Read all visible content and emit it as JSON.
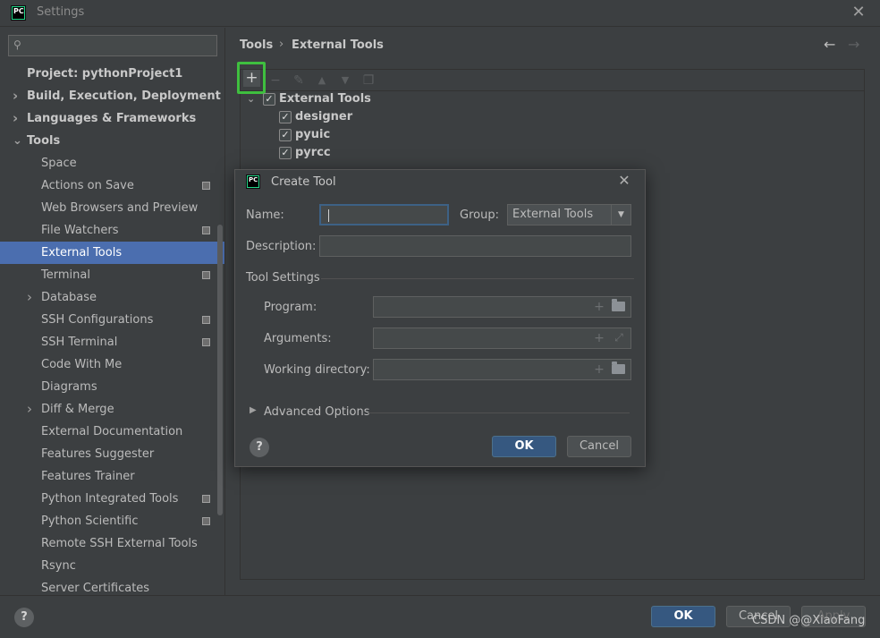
{
  "window": {
    "title": "Settings",
    "logo_text": "PC"
  },
  "sidebar": {
    "search_placeholder": "",
    "project_item": "Project: pythonProject1",
    "items": [
      {
        "label": "Build, Execution, Deployment",
        "bold": true,
        "expandable": true
      },
      {
        "label": "Languages & Frameworks",
        "bold": true,
        "expandable": true
      },
      {
        "label": "Tools",
        "bold": true,
        "expanded": true
      },
      {
        "label": "Space"
      },
      {
        "label": "Actions on Save",
        "project_scoped": true
      },
      {
        "label": "Web Browsers and Preview"
      },
      {
        "label": "File Watchers",
        "project_scoped": true
      },
      {
        "label": "External Tools",
        "selected": true
      },
      {
        "label": "Terminal",
        "project_scoped": true
      },
      {
        "label": "Database",
        "expandable": true
      },
      {
        "label": "SSH Configurations",
        "project_scoped": true
      },
      {
        "label": "SSH Terminal",
        "project_scoped": true
      },
      {
        "label": "Code With Me"
      },
      {
        "label": "Diagrams"
      },
      {
        "label": "Diff & Merge",
        "expandable": true
      },
      {
        "label": "External Documentation"
      },
      {
        "label": "Features Suggester"
      },
      {
        "label": "Features Trainer"
      },
      {
        "label": "Python Integrated Tools",
        "project_scoped": true
      },
      {
        "label": "Python Scientific",
        "project_scoped": true
      },
      {
        "label": "Remote SSH External Tools"
      },
      {
        "label": "Rsync"
      },
      {
        "label": "Server Certificates"
      }
    ]
  },
  "breadcrumb": {
    "parent": "Tools",
    "separator": "›",
    "current": "External Tools",
    "back_icon": "arrow-left-icon",
    "forward_icon": "arrow-right-icon"
  },
  "toolbar": {
    "add": "+",
    "remove": "−",
    "edit": "✎",
    "up": "▲",
    "down": "▼",
    "copy": "❐"
  },
  "tools_tree": {
    "group": {
      "label": "External Tools",
      "checked": true
    },
    "items": [
      {
        "label": "designer",
        "checked": true
      },
      {
        "label": "pyuic",
        "checked": true
      },
      {
        "label": "pyrcc",
        "checked": true
      }
    ]
  },
  "dialog": {
    "title": "Create Tool",
    "logo_text": "PC",
    "name_label": "Name:",
    "name_value": "",
    "group_label": "Group:",
    "group_value": "External Tools",
    "description_label": "Description:",
    "description_value": "",
    "tool_settings_label": "Tool Settings",
    "program_label": "Program:",
    "program_value": "",
    "arguments_label": "Arguments:",
    "arguments_value": "",
    "working_dir_label": "Working directory:",
    "working_dir_value": "",
    "advanced_label": "Advanced Options",
    "ok_label": "OK",
    "cancel_label": "Cancel",
    "help_label": "?"
  },
  "footer": {
    "help_label": "?",
    "ok_label": "OK",
    "cancel_label": "Cancel",
    "apply_label": "Apply"
  },
  "watermark": "CSDN @@XiaoFang",
  "colors": {
    "background": "#3c3f41",
    "selection": "#4b6eaf",
    "primary_button": "#365880",
    "highlight_box": "#3fbf3f"
  }
}
